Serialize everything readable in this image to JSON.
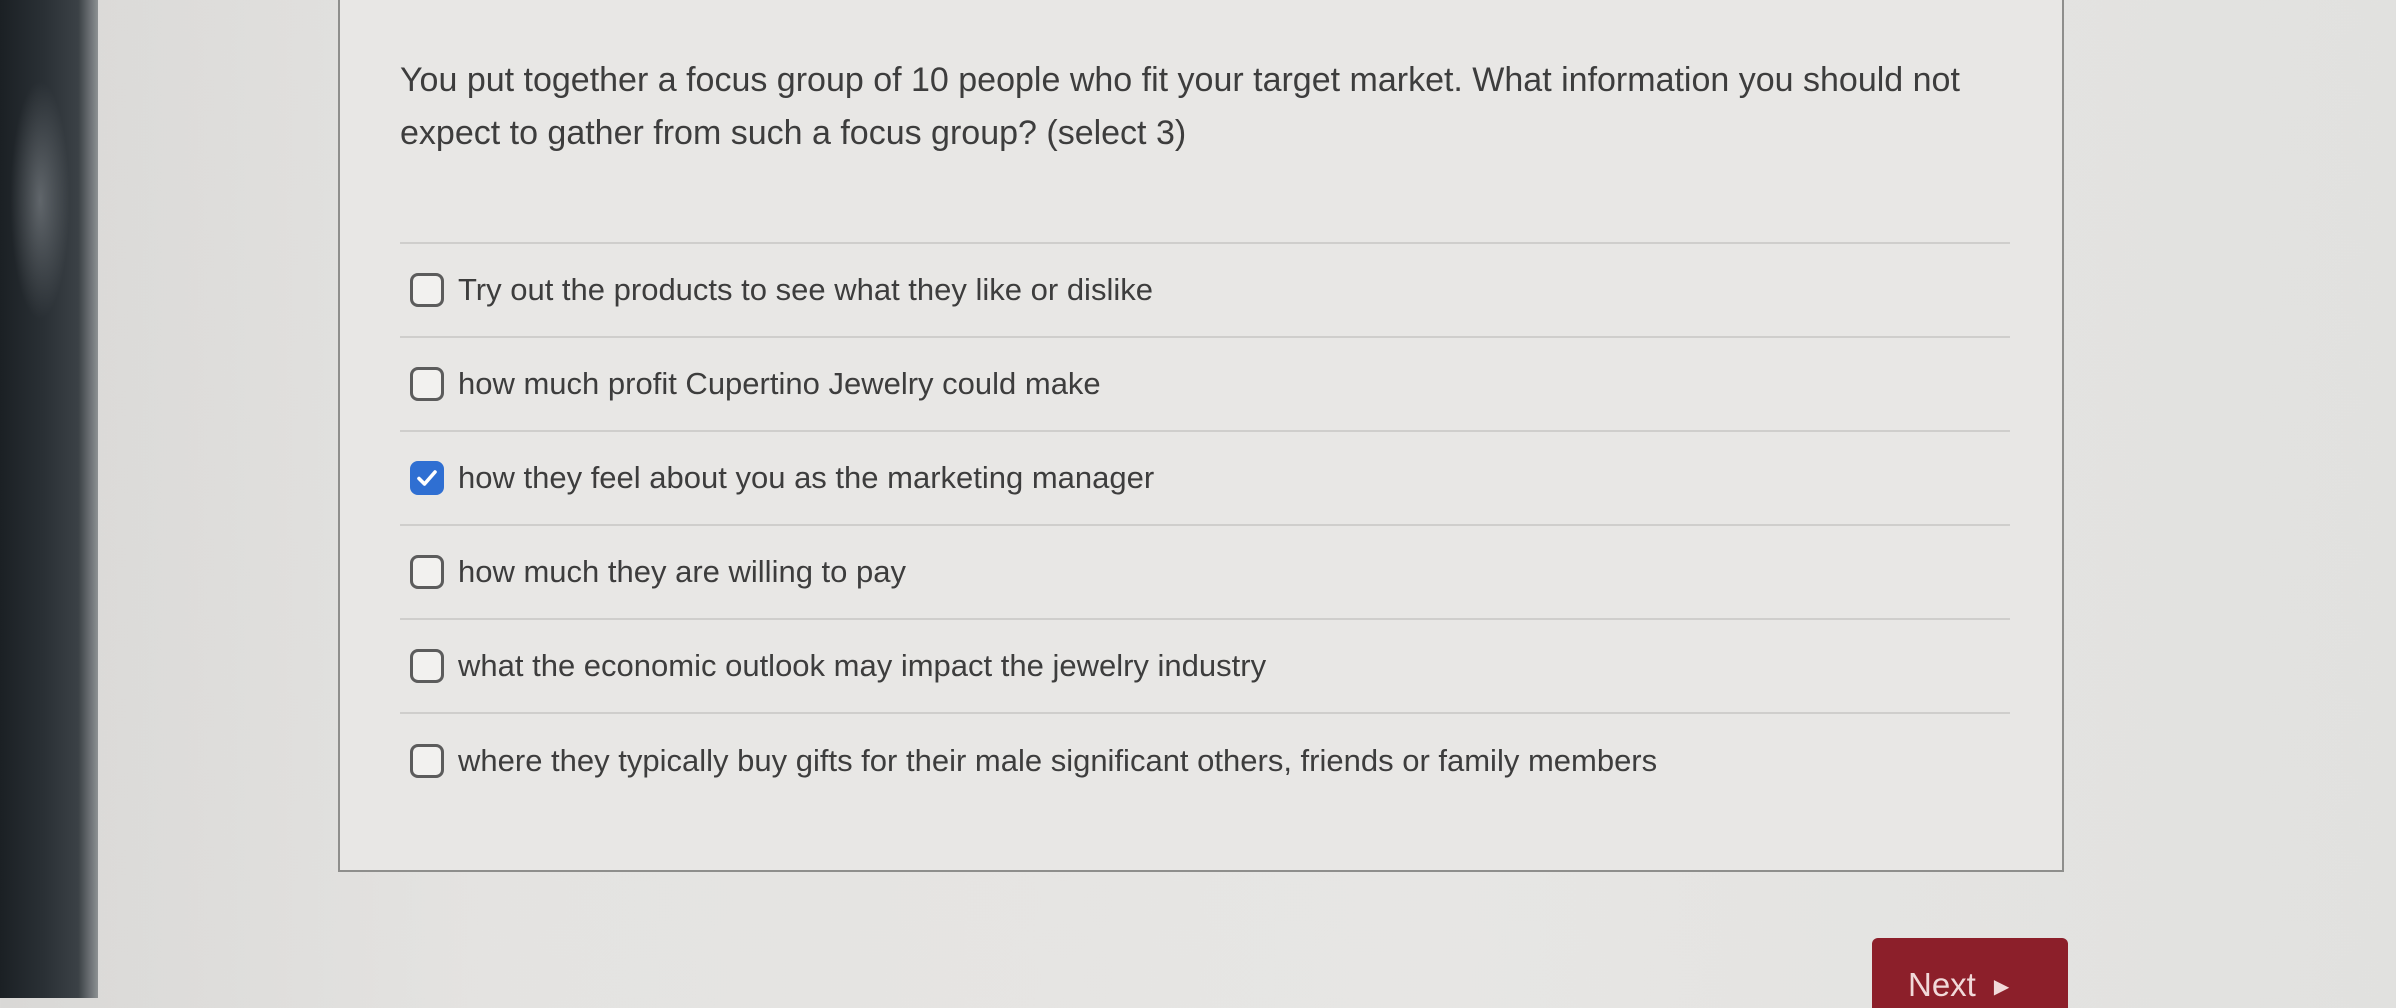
{
  "question": {
    "text": "You put together a focus group of 10 people who fit your target market. What information you should not expect to gather from such a focus group? (select 3)"
  },
  "options": [
    {
      "label": "Try out the products to see what they like or dislike",
      "checked": false
    },
    {
      "label": "how much profit Cupertino Jewelry could make",
      "checked": false
    },
    {
      "label": "how they feel about you as the marketing manager",
      "checked": true
    },
    {
      "label": "how much they are willing to pay",
      "checked": false
    },
    {
      "label": "what the economic outlook may impact the jewelry industry",
      "checked": false
    },
    {
      "label": "where they typically buy gifts for their male significant others, friends or family members",
      "checked": false
    }
  ],
  "navigation": {
    "next_label": "Next",
    "next_icon": "play-arrow-icon"
  },
  "colors": {
    "checkbox_checked": "#2f6fd2",
    "next_button": "#8c1f2a",
    "text": "#3d3d3d"
  }
}
